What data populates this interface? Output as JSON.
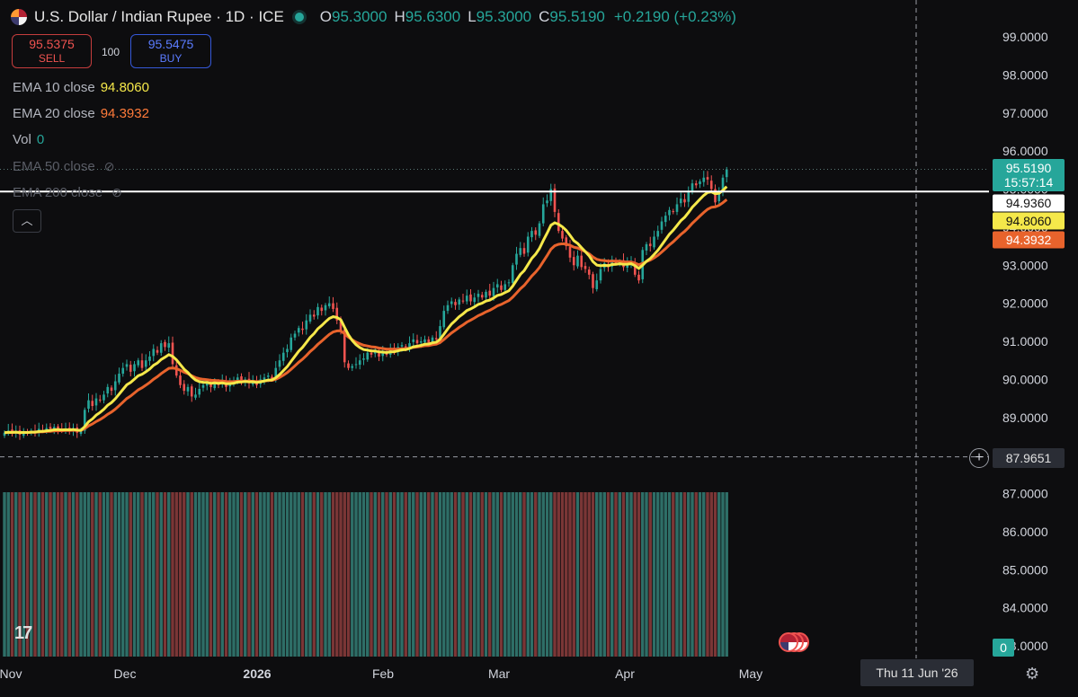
{
  "header": {
    "title": "U.S. Dollar / Indian Rupee · 1D · ICE",
    "ohlc": [
      {
        "k": "O",
        "v": "95.3000"
      },
      {
        "k": "H",
        "v": "95.6300"
      },
      {
        "k": "L",
        "v": "95.3000"
      },
      {
        "k": "C",
        "v": "95.5190"
      }
    ],
    "change": "+0.2190 (+0.23%)"
  },
  "trade": {
    "sell_price": "95.5375",
    "sell_label": "SELL",
    "quantity": "100",
    "buy_price": "95.5475",
    "buy_label": "BUY"
  },
  "indicators": [
    {
      "name": "EMA 10 close",
      "value": "94.8060",
      "color": "#f5e84a",
      "visible": true
    },
    {
      "name": "EMA 20 close",
      "value": "94.3932",
      "color": "#ff7b3a",
      "visible": true
    },
    {
      "name": "Vol",
      "value": "0",
      "color": "#26a69a",
      "visible": true
    },
    {
      "name": "EMA 50 close",
      "value": "",
      "color": "#5a5d66",
      "visible": false
    },
    {
      "name": "EMA 200 close",
      "value": "",
      "color": "#5a5d66",
      "visible": false
    }
  ],
  "colors": {
    "up": "#26a69a",
    "down": "#ef5350",
    "ema10": "#f5e84a",
    "ema20": "#e8632c",
    "background": "#0d0d0f",
    "hline": "#ffffff"
  },
  "icons": [
    "flag-usd-inr-icon",
    "eye-hidden-icon",
    "chevron-up-icon",
    "tradingview-logo-icon",
    "crosshair-add-icon",
    "settings-gear-icon",
    "currency-event-icon"
  ],
  "chart_data": {
    "type": "candlestick",
    "symbol": "USD/INR",
    "interval": "1D",
    "y_ticks": [
      "99.0000",
      "98.0000",
      "97.0000",
      "96.0000",
      "95.0000",
      "94.0000",
      "93.0000",
      "92.0000",
      "91.0000",
      "90.0000",
      "89.0000",
      "88.0000",
      "87.0000",
      "86.0000",
      "85.0000",
      "84.0000",
      "83.0000"
    ],
    "x_ticks": [
      "Nov",
      "Dec",
      "2026",
      "Feb",
      "Mar",
      "Apr",
      "May"
    ],
    "ylim": [
      82.5,
      99.5
    ],
    "last_price": "95.5190",
    "countdown": "15:57:14",
    "horizontal_line": "94.9360",
    "ema10_label": "94.8060",
    "ema20_label": "94.3932",
    "crosshair_price": "87.9651",
    "crosshair_date": "Thu 11 Jun '26",
    "volume_label": "0",
    "close": [
      88.6,
      88.65,
      88.6,
      88.65,
      88.55,
      88.62,
      88.6,
      88.65,
      88.62,
      88.7,
      88.65,
      88.72,
      88.7,
      88.75,
      88.7,
      88.65,
      88.7,
      88.65,
      88.72,
      88.6,
      88.65,
      89.2,
      89.45,
      89.3,
      89.5,
      89.45,
      89.6,
      89.8,
      89.7,
      89.95,
      90.15,
      90.3,
      90.4,
      90.2,
      90.4,
      90.5,
      90.3,
      90.5,
      90.6,
      90.8,
      90.7,
      90.95,
      90.85,
      90.95,
      90.4,
      90.1,
      89.85,
      89.7,
      89.8,
      89.55,
      89.6,
      89.75,
      89.85,
      89.9,
      89.8,
      89.95,
      89.85,
      89.95,
      89.8,
      89.9,
      89.95,
      90.05,
      89.95,
      90.0,
      89.9,
      89.95,
      89.85,
      90.0,
      90.05,
      90.1,
      90.0,
      90.3,
      90.5,
      90.7,
      90.8,
      91.1,
      91.2,
      91.35,
      91.3,
      91.55,
      91.7,
      91.65,
      91.9,
      91.8,
      91.95,
      92.0,
      91.85,
      91.55,
      91.3,
      90.45,
      90.3,
      90.35,
      90.4,
      90.5,
      90.55,
      90.7,
      90.65,
      90.75,
      90.6,
      90.7,
      90.65,
      90.8,
      90.75,
      90.85,
      90.9,
      90.8,
      90.95,
      91.05,
      90.95,
      91.0,
      91.05,
      90.95,
      91.1,
      91.05,
      91.4,
      91.8,
      91.95,
      92.05,
      91.95,
      92.1,
      92.05,
      92.2,
      92.05,
      92.15,
      92.25,
      92.15,
      92.3,
      92.2,
      92.4,
      92.5,
      92.35,
      92.5,
      92.55,
      93.0,
      93.3,
      93.45,
      93.3,
      93.75,
      93.9,
      93.8,
      94.1,
      94.6,
      94.7,
      95.0,
      94.4,
      93.9,
      93.7,
      93.5,
      93.2,
      93.0,
      93.25,
      92.95,
      92.9,
      92.75,
      92.4,
      92.6,
      92.9,
      93.05,
      92.95,
      93.15,
      93.05,
      93.1,
      92.95,
      93.05,
      93.1,
      92.75,
      92.6,
      93.4,
      93.55,
      93.5,
      93.75,
      93.9,
      94.15,
      94.3,
      94.45,
      94.4,
      94.6,
      94.75,
      94.65,
      94.95,
      95.15,
      95.1,
      95.2,
      95.3,
      95.25,
      95.0,
      94.65,
      94.95,
      95.3,
      95.52
    ]
  }
}
